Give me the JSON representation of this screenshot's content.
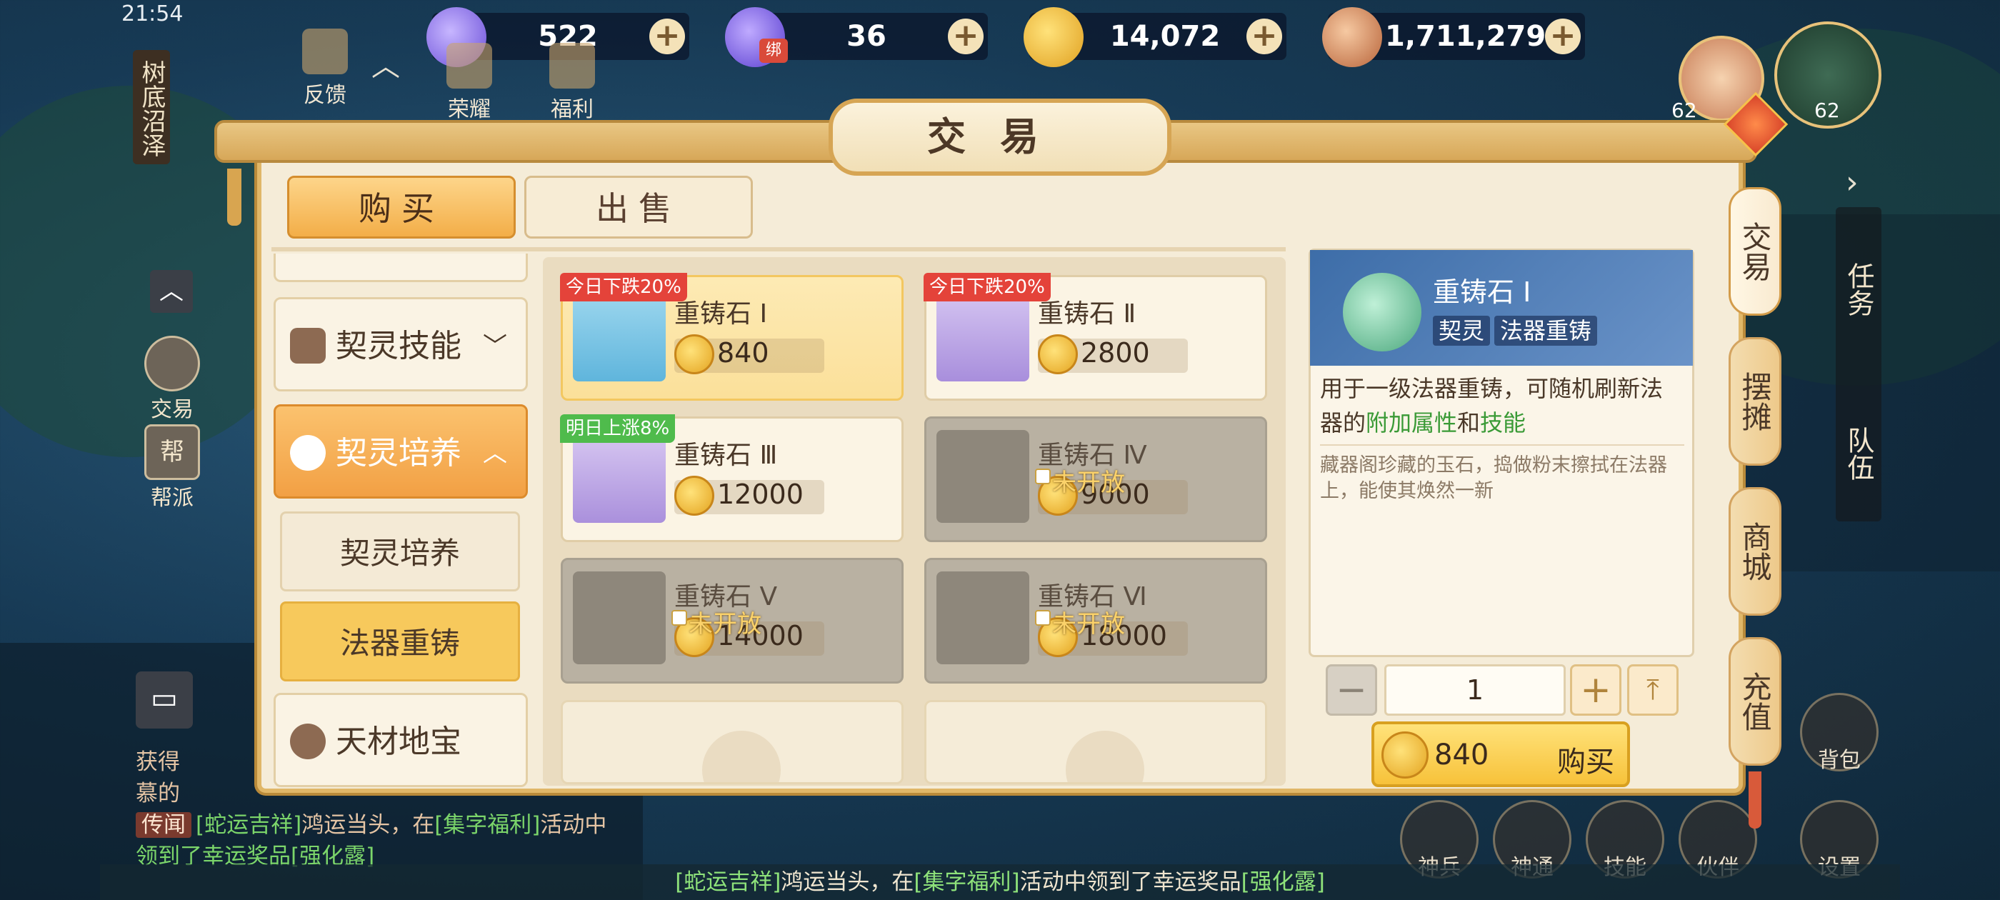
{
  "status": {
    "time": "21:54"
  },
  "currencies": [
    {
      "name": "jade",
      "value": "522",
      "color": "#8a6ee8"
    },
    {
      "name": "bound-jade",
      "value": "36",
      "color": "#7a5ae0",
      "tag": "绑"
    },
    {
      "name": "gold",
      "value": "14,072",
      "color": "#f3b52a"
    },
    {
      "name": "copper",
      "value": "1,711,279",
      "color": "#c87a4a"
    }
  ],
  "top_icons": {
    "feedback": "反馈",
    "honor": "荣耀",
    "welfare": "福利"
  },
  "location": "树底沼泽",
  "left_side": {
    "trade": "交易",
    "guild": "帮派",
    "guild_icon": "帮"
  },
  "player_levels": {
    "pet": "62",
    "player": "62"
  },
  "right_side": {
    "task": "任务",
    "team": "队伍",
    "bag": "背包"
  },
  "bottom_icons": [
    "神兵",
    "神通",
    "技能",
    "伙伴",
    "设置"
  ],
  "window": {
    "title": "交易",
    "tabs": {
      "buy": "购买",
      "sell": "出售"
    },
    "categories": [
      {
        "label": "契灵技能",
        "expanded": false
      },
      {
        "label": "契灵培养",
        "expanded": true
      }
    ],
    "subcategories": [
      {
        "label": "契灵培养",
        "selected": false
      },
      {
        "label": "法器重铸",
        "selected": true
      }
    ],
    "category_bottom": "天材地宝",
    "items": [
      {
        "name": "重铸石 Ⅰ",
        "price": "840",
        "badge": "今日下跌20%",
        "badge_type": "down",
        "locked": false,
        "selected": true
      },
      {
        "name": "重铸石 Ⅱ",
        "price": "2800",
        "badge": "今日下跌20%",
        "badge_type": "down",
        "locked": false,
        "selected": false
      },
      {
        "name": "重铸石 Ⅲ",
        "price": "12000",
        "badge": "明日上涨8%",
        "badge_type": "up",
        "locked": false,
        "selected": false
      },
      {
        "name": "重铸石 Ⅳ",
        "price": "9000",
        "badge": "",
        "locked": true,
        "lock_text": "未开放"
      },
      {
        "name": "重铸石 Ⅴ",
        "price": "14000",
        "badge": "",
        "locked": true,
        "lock_text": "未开放"
      },
      {
        "name": "重铸石 Ⅵ",
        "price": "18000",
        "badge": "",
        "locked": true,
        "lock_text": "未开放"
      }
    ],
    "detail": {
      "name": "重铸石 Ⅰ",
      "tag1": "契灵",
      "tag2": "法器重铸",
      "desc_pre": "用于一级法器重铸，可随机刷新法器的",
      "desc_hl1": "附加属性",
      "desc_mid": "和",
      "desc_hl2": "技能",
      "flavor": "藏器阁珍藏的玉石，捣做粉末擦拭在法器上，能使其焕然一新"
    },
    "quantity": "1",
    "buy": {
      "price": "840",
      "label": "购买"
    },
    "side_tabs": [
      "交易",
      "摆摊",
      "商城",
      "充值"
    ]
  },
  "chat": {
    "line1": "获得",
    "line2": "慕的",
    "tag": "传闻",
    "msg_a": "[蛇运吉祥]",
    "msg_b": "鸿运当头，在",
    "msg_c": "[集字福利]",
    "msg_d": "活动中",
    "msg_e": "领到了幸运奖品",
    "msg_f": "[强化露]"
  },
  "banner": {
    "a": "[蛇运吉祥]",
    "b": "鸿运当头，在",
    "c": "[集字福利]",
    "d": "活动中领到了幸运奖品",
    "e": "[强化露]"
  }
}
